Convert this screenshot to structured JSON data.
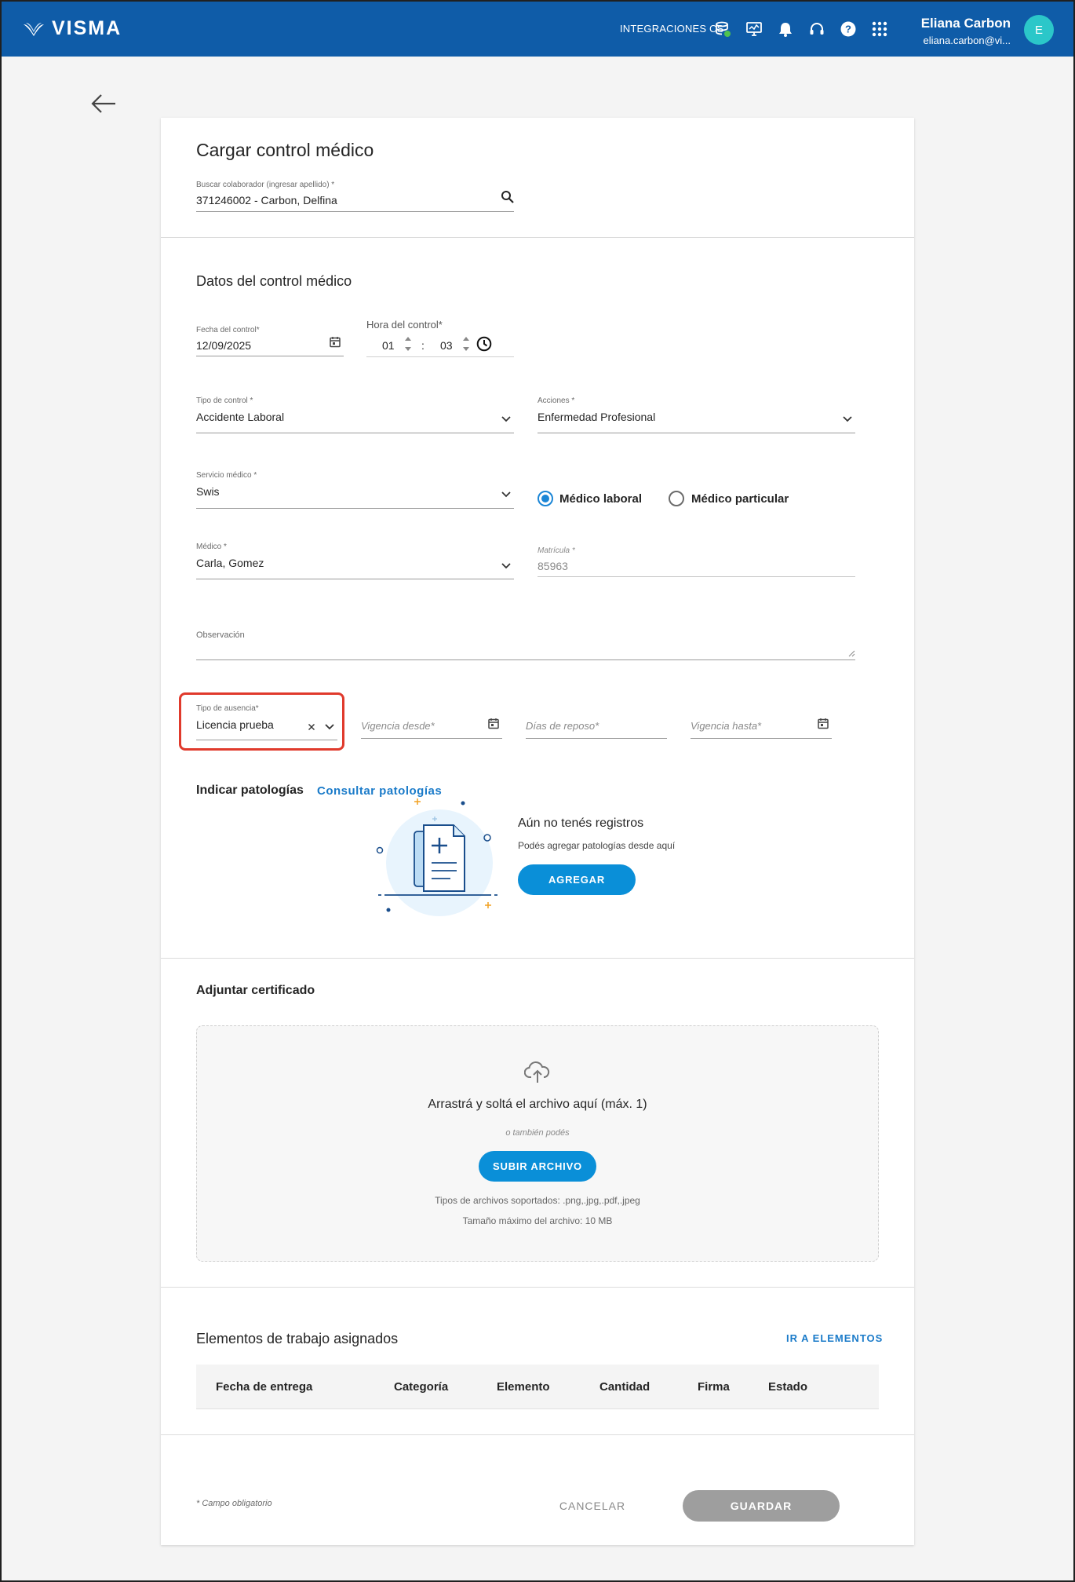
{
  "header": {
    "brand": "VISMA",
    "integrations": "INTEGRACIONES CS",
    "user_name": "Eliana Carbon",
    "user_email": "eliana.carbon@vi...",
    "avatar_initial": "E"
  },
  "form": {
    "title": "Cargar control médico",
    "collaborator": {
      "label": "Buscar colaborador (ingresar apellido) *",
      "value": "371246002 - Carbon, Delfina"
    },
    "section_title": "Datos del control médico",
    "date": {
      "label": "Fecha del control*",
      "value": "12/09/2025"
    },
    "time": {
      "label": "Hora del control*",
      "hours": "01",
      "separator": ":",
      "minutes": "03"
    },
    "control_type": {
      "label": "Tipo de control *",
      "value": "Accidente Laboral"
    },
    "actions": {
      "label": "Acciones *",
      "value": "Enfermedad Profesional"
    },
    "medical_service": {
      "label": "Servicio médico *",
      "value": "Swis"
    },
    "radio_options": [
      "Médico laboral",
      "Médico particular"
    ],
    "doctor": {
      "label": "Médico *",
      "value": "Carla, Gomez"
    },
    "license": {
      "label": "Matrícula *",
      "value": "85963"
    },
    "observation": {
      "label": "Observación"
    },
    "absence_type": {
      "label": "Tipo de ausencia*",
      "value": "Licencia prueba"
    },
    "valid_from": {
      "placeholder": "Vigencia desde*"
    },
    "rest_days": {
      "placeholder": "Días de reposo*"
    },
    "valid_to": {
      "placeholder": "Vigencia hasta*"
    }
  },
  "pathologies": {
    "title": "Indicar patologías",
    "link": "Consultar patologías",
    "empty_title": "Aún no tenés registros",
    "empty_sub": "Podés agregar patologías desde aquí",
    "add_button": "AGREGAR"
  },
  "certificate": {
    "title": "Adjuntar certificado",
    "drop_text": "Arrastrá y soltá el archivo aquí (máx. 1)",
    "or_text": "o también podés",
    "upload_button": "SUBIR ARCHIVO",
    "types": "Tipos de archivos soportados: .png,.jpg,.pdf,.jpeg",
    "max_size": "Tamaño máximo del archivo: 10 MB"
  },
  "work_elements": {
    "title": "Elementos de trabajo asignados",
    "link": "IR A ELEMENTOS",
    "columns": [
      "Fecha de entrega",
      "Categoría",
      "Elemento",
      "Cantidad",
      "Firma",
      "Estado"
    ]
  },
  "footer": {
    "required_note": "* Campo obligatorio",
    "cancel": "CANCELAR",
    "save": "GUARDAR"
  },
  "colors": {
    "header": "#0f5ca8",
    "primary": "#0a8fd8",
    "highlight": "#e03a2c",
    "avatar": "#2bc7c9"
  },
  "icons": [
    "visma-logo-icon",
    "database-icon",
    "monitor-icon",
    "bell-icon",
    "headset-icon",
    "help-icon",
    "apps-grid-icon",
    "back-arrow-icon",
    "search-icon",
    "calendar-icon",
    "clock-icon",
    "chevron-down-icon",
    "clear-icon",
    "cloud-upload-icon",
    "document-plus-illustration"
  ]
}
